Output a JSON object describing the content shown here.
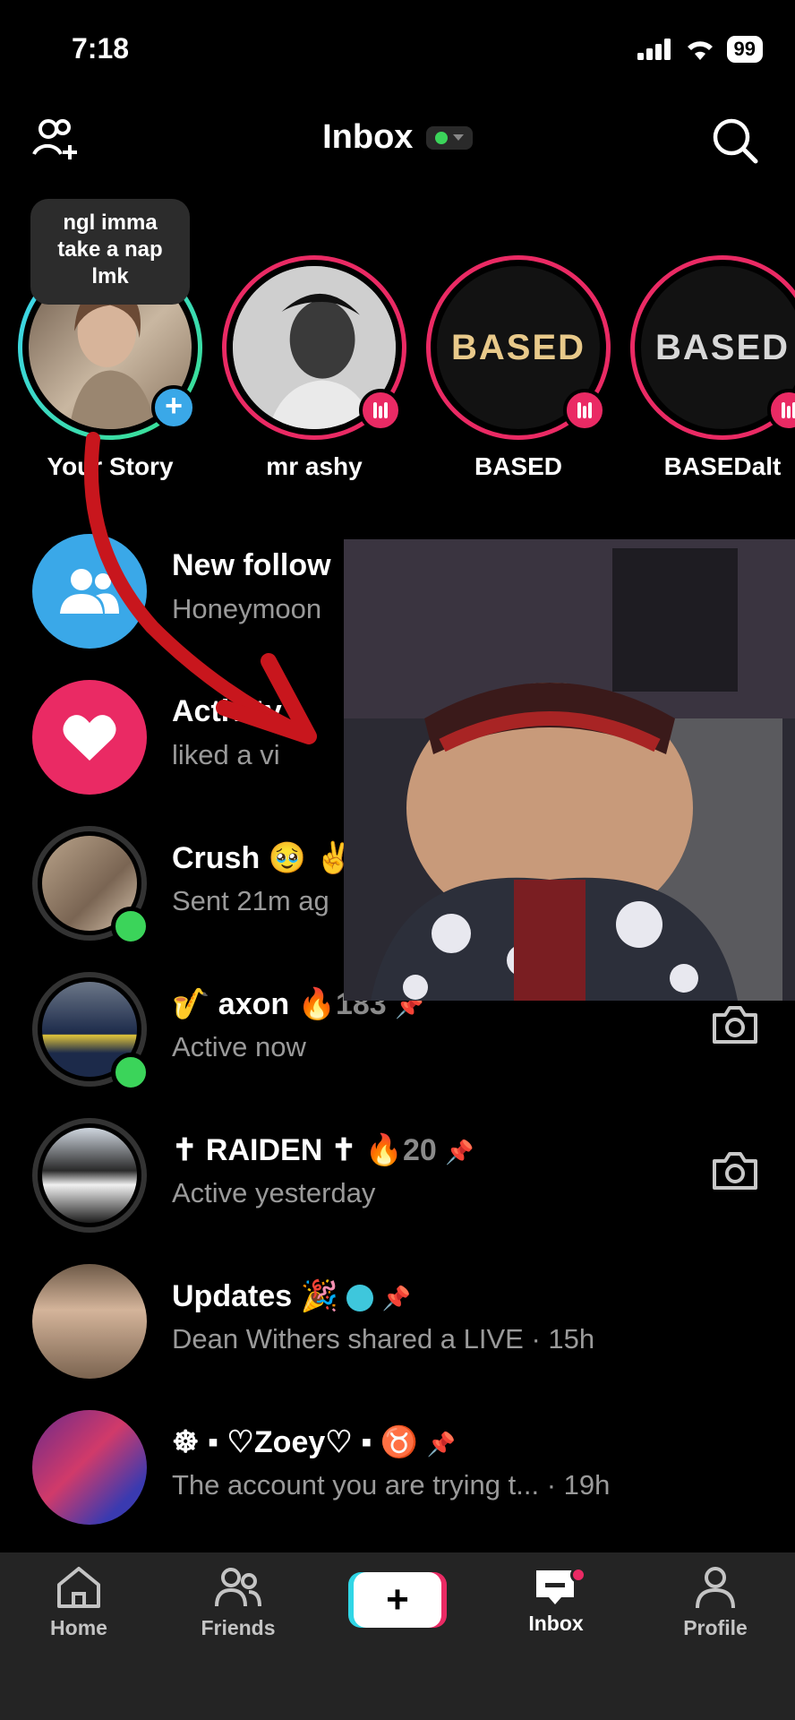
{
  "status_bar": {
    "time": "7:18",
    "battery": "99"
  },
  "header": {
    "title": "Inbox"
  },
  "tooltip": {
    "text_line1": "ngl imma",
    "text_line2": "take a nap",
    "text_line3": "lmk"
  },
  "stories": [
    {
      "name": "Your Story"
    },
    {
      "name": "mr ashy"
    },
    {
      "name": "BASED",
      "logo": "BASED"
    },
    {
      "name": "BASEDalt",
      "logo": "BASED"
    }
  ],
  "rows": [
    {
      "title": "New follow",
      "subtitle": "Honeymoon"
    },
    {
      "title": "Activity",
      "subtitle": "liked a vi"
    },
    {
      "title": "Crush 🥹 ✌",
      "subtitle": "Sent 21m ag"
    },
    {
      "title": "🎷 axon",
      "streak": "183",
      "subtitle": "Active now"
    },
    {
      "title": "✝ RAIDEN ✝",
      "streak": "20",
      "subtitle": "Active yesterday"
    },
    {
      "title": "Updates 🎉",
      "subtitle": "Dean Withers shared a LIVE · 15h"
    },
    {
      "title": "☸ ▪ ♡Zoey♡ ▪ ♉",
      "subtitle": "The account you are trying t... · 19h"
    }
  ],
  "tabs": [
    {
      "label": "Home"
    },
    {
      "label": "Friends"
    },
    {
      "label": "Inbox"
    },
    {
      "label": "Profile"
    }
  ],
  "colors": {
    "accent": "#ea2a64",
    "online": "#3bd45a",
    "followers_blue": "#3aa8e8"
  }
}
